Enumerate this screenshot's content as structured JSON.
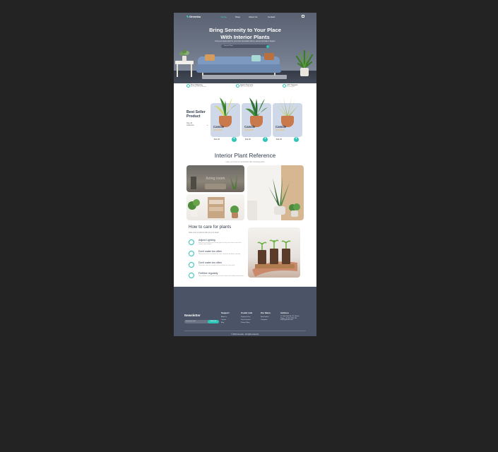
{
  "nav": {
    "logo": "Greenko",
    "links": [
      "Home",
      "Shop",
      "About Us",
      "Contact"
    ]
  },
  "hero": {
    "title_line1": "Bring Serenity to Your Place",
    "title_line2": "With Interior Plants",
    "subtitle": "Find your dream plant for your home decoration with us, and we will make it happen",
    "search_placeholder": "Search Plant"
  },
  "features": [
    {
      "title": "Free Shipping",
      "sub": "No charge for each delivery"
    },
    {
      "title": "Quick Payment",
      "sub": "100% secure payment"
    },
    {
      "title": "24/7 Support",
      "sub": "Quick support"
    }
  ],
  "best_seller": {
    "title": "Best Seller Product",
    "link": "See all collection",
    "products": [
      {
        "name": "Camille",
        "stars": "★★★★★",
        "price": "$41.00"
      },
      {
        "name": "Camille",
        "stars": "★★★★★",
        "price": "$41.00"
      },
      {
        "name": "Camille",
        "stars": "★★★★★",
        "price": "$44.00"
      }
    ]
  },
  "reference": {
    "title": "Interior Plant Reference",
    "subtitle": "make your home so comfortable with refreshing plants",
    "label": "living room"
  },
  "care": {
    "title": "How to care for plants",
    "subtitle": "Take care of plants with all your heart",
    "items": [
      {
        "title": "Adjust Lighting",
        "desc": "Make sure your plants get enough light in a day, move them closer to the window when needed"
      },
      {
        "title": "Don't water too often",
        "desc": "Watering too much can drown the roots, check the soil before watering"
      },
      {
        "title": "Don't water too often",
        "desc": "Only water when the top layer of the soil feels dry to the touch"
      },
      {
        "title": "Fertilize regularly",
        "desc": "Give nutrients to your plants every month to keep them healthy and growing"
      }
    ]
  },
  "footer": {
    "newsletter_title": "Newsletter",
    "newsletter_placeholder": "Insert your mail",
    "subscribe": "Subscribe",
    "columns": [
      {
        "heading": "Support",
        "items": [
          "About us",
          "Careers",
          "Blog"
        ]
      },
      {
        "heading": "Useful Link",
        "items": [
          "Payment & Tax",
          "Term of service",
          "Privacy Policy"
        ]
      },
      {
        "heading": "Our Menu",
        "items": [
          "Best Product",
          "Categories"
        ]
      },
      {
        "heading": "Address",
        "items": [
          "JL. Setia Budi No. 24, Jakarta",
          "Phone: +62 812 3456 789",
          "hello@greenko.com"
        ]
      }
    ],
    "copyright": "© 2022 Greenko - All rights reserved."
  }
}
